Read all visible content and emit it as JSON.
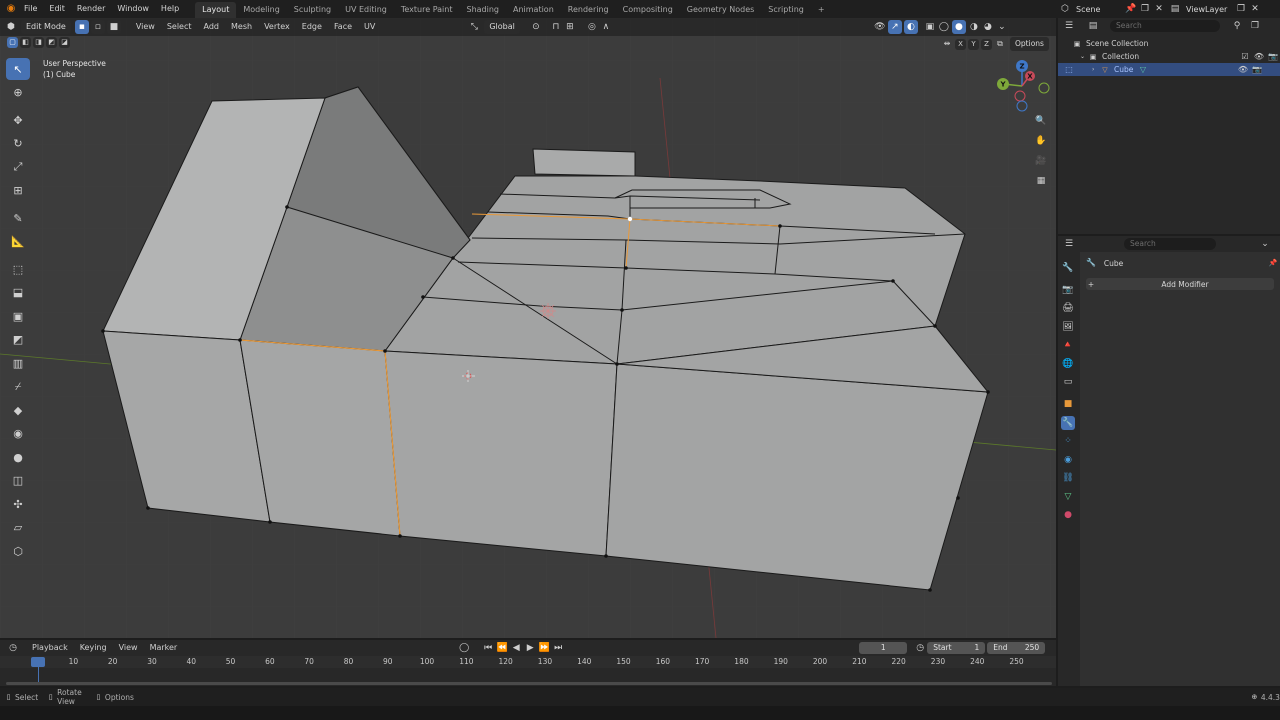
{
  "app": {
    "name": "Blender",
    "version": "4.4.3"
  },
  "menu": [
    "File",
    "Edit",
    "Render",
    "Window",
    "Help"
  ],
  "workspaces": [
    "Layout",
    "Modeling",
    "Sculpting",
    "UV Editing",
    "Texture Paint",
    "Shading",
    "Animation",
    "Rendering",
    "Compositing",
    "Geometry Nodes",
    "Scripting"
  ],
  "active_workspace": "Layout",
  "scene": {
    "name": "Scene",
    "view_layer": "ViewLayer"
  },
  "viewport": {
    "mode": "Edit Mode",
    "menus": [
      "View",
      "Select",
      "Add",
      "Mesh",
      "Vertex",
      "Edge",
      "Face",
      "UV"
    ],
    "orientation": "Global",
    "options_label": "Options",
    "axis_labels": [
      "X",
      "Y",
      "Z"
    ],
    "overlay_title": "User Perspective",
    "overlay_object": "(1) Cube",
    "gizmo_axes": {
      "x": "X",
      "y": "Y",
      "z": "Z"
    },
    "colors": {
      "background": "#3c3c3c",
      "mesh_face": "#a6a7a7",
      "seam_edge": "#e8993a",
      "selected": "#ffffff"
    }
  },
  "outliner": {
    "search_placeholder": "Search",
    "items": [
      {
        "label": "Scene Collection",
        "level": 0
      },
      {
        "label": "Collection",
        "level": 1
      },
      {
        "label": "Cube",
        "level": 2,
        "selected": true
      }
    ]
  },
  "properties": {
    "search_placeholder": "Search",
    "object_name": "Cube",
    "add_modifier_label": "Add Modifier",
    "tabs": [
      "tool",
      "render",
      "output",
      "view-layer",
      "scene",
      "world",
      "collection",
      "object",
      "modifiers",
      "particles",
      "physics",
      "constraints",
      "data",
      "material"
    ],
    "active_tab": "modifiers"
  },
  "timeline": {
    "menus": [
      "Playback",
      "Keying",
      "View",
      "Marker"
    ],
    "current_frame": "1",
    "start_label": "Start",
    "start": "1",
    "end_label": "End",
    "end": "250",
    "ruler_labels": [
      "1",
      "10",
      "20",
      "30",
      "40",
      "50",
      "60",
      "70",
      "80",
      "90",
      "100",
      "110",
      "120",
      "130",
      "140",
      "150",
      "160",
      "170",
      "180",
      "190",
      "200",
      "210",
      "220",
      "230",
      "240",
      "250"
    ]
  },
  "statusbar": {
    "select": "Select",
    "rotate": "Rotate View",
    "options": "Options",
    "version": "4.4.3"
  }
}
